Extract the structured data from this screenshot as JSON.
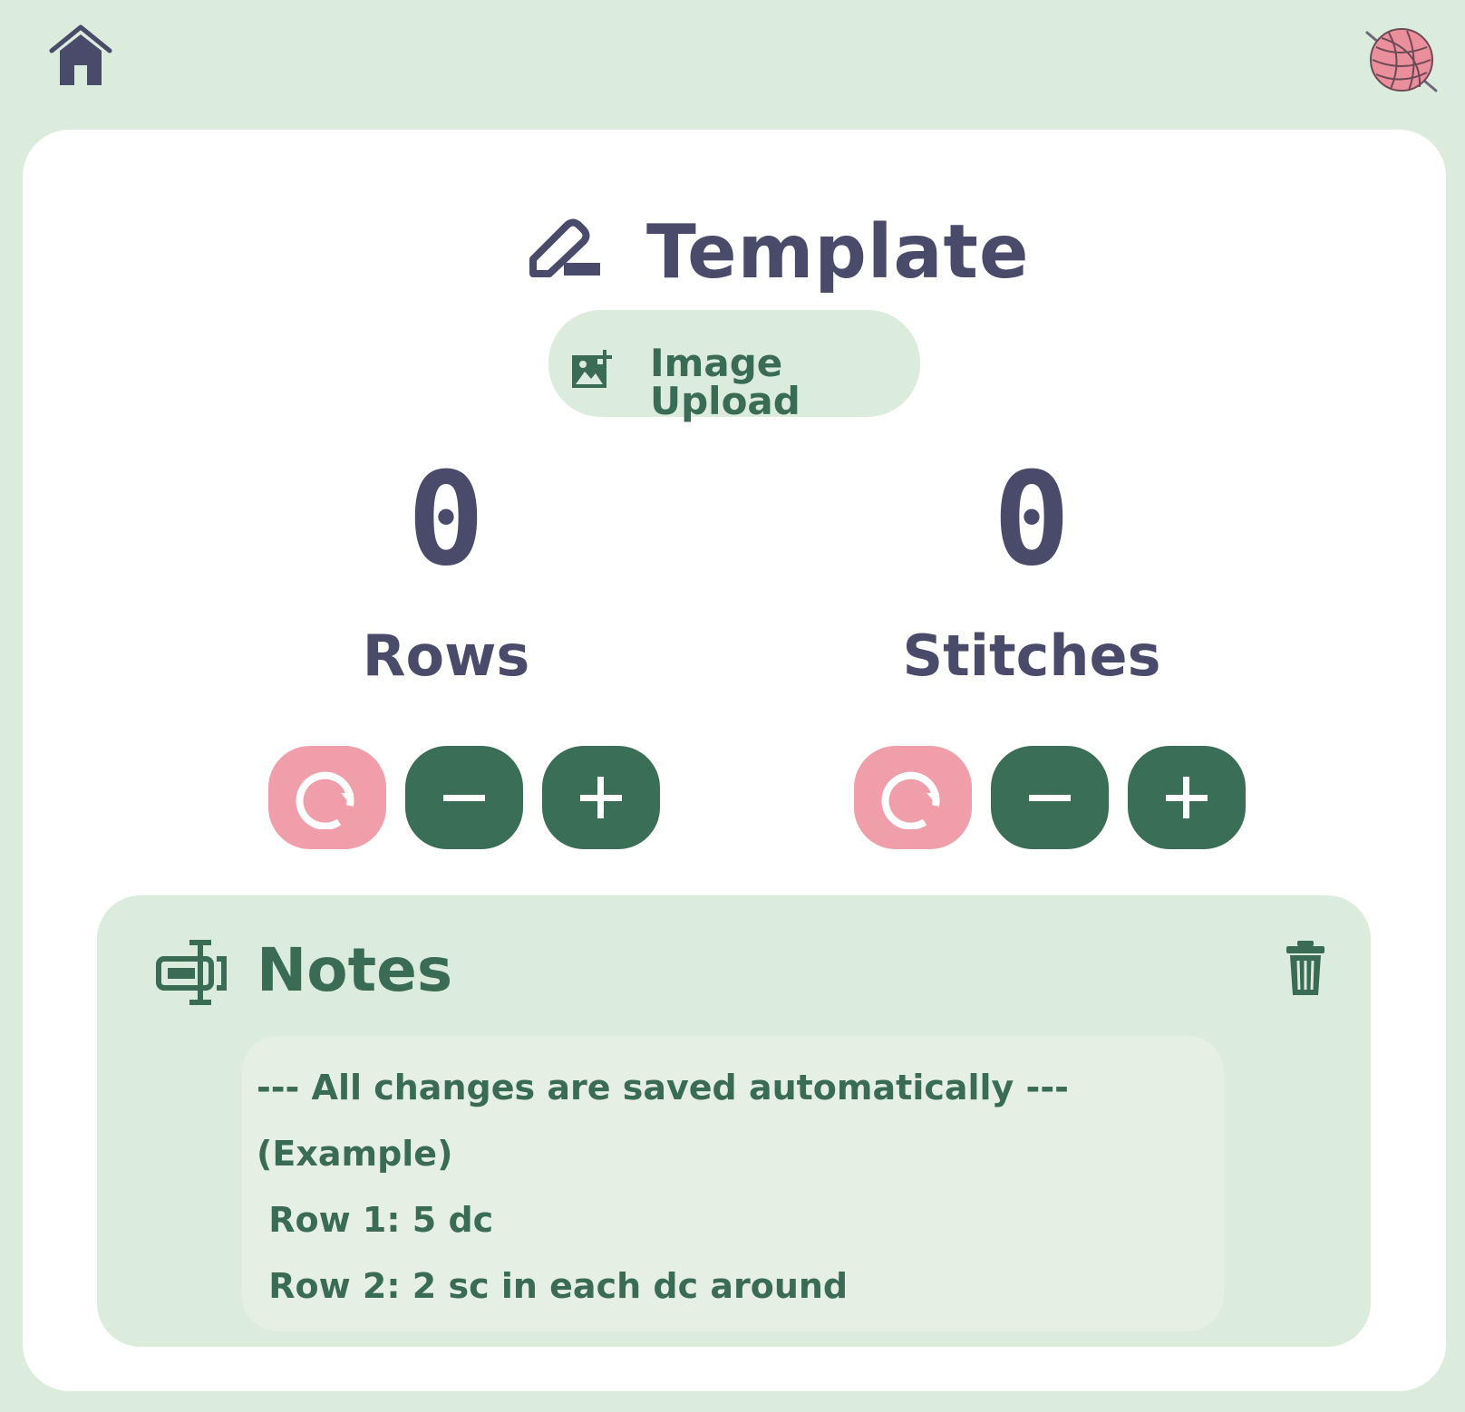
{
  "header": {
    "home_icon": "home-icon",
    "logo_icon": "yarn-ball-icon"
  },
  "page": {
    "title": "Template",
    "title_icon": "pencil-icon"
  },
  "upload": {
    "label": "Image Upload",
    "icon": "add-image-icon"
  },
  "counters": [
    {
      "label": "Rows",
      "value": "0"
    },
    {
      "label": "Stitches",
      "value": "0"
    }
  ],
  "counter_buttons": {
    "reset_icon": "reset-icon",
    "minus_icon": "minus-icon",
    "plus_icon": "plus-icon"
  },
  "notes": {
    "title": "Notes",
    "icon": "text-cursor-icon",
    "delete_icon": "trash-icon",
    "lines": [
      "--- All changes are saved automatically ---",
      "(Example)",
      " Row 1: 5 dc",
      " Row 2: 2 sc in each dc around"
    ]
  },
  "colors": {
    "background": "#dcecdc",
    "card": "#ffffff",
    "heading": "#4a4a6a",
    "accent_green": "#3b6e56",
    "accent_pink": "#f09ea9"
  }
}
